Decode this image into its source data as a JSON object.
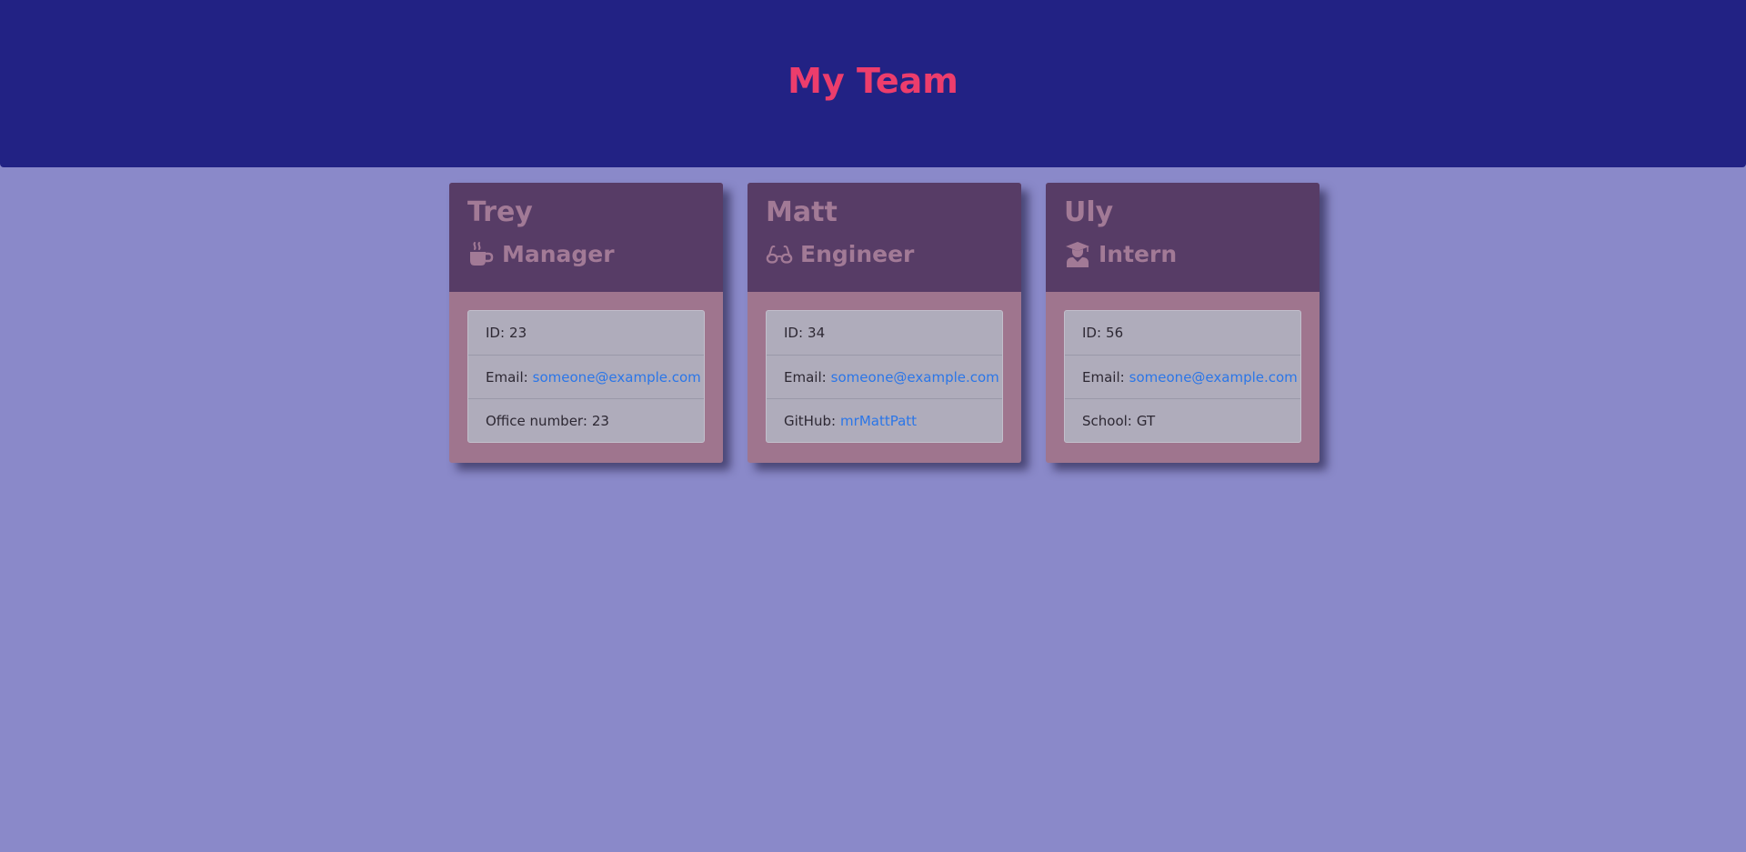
{
  "header": {
    "title": "My Team"
  },
  "colors": {
    "background": "#8a89c9",
    "header_background": "#222284",
    "title": "#ec3d6c",
    "card_header": "#573c66",
    "card_body": "#9f758e",
    "card_header_text": "#a27a96",
    "list_background": "#afacbb",
    "link": "#2b76e8"
  },
  "team": [
    {
      "name": "Trey",
      "role": "Manager",
      "icon": "mug-icon",
      "id_label": "ID:",
      "id": "23",
      "email_label": "Email:",
      "email": "someone@example.com",
      "extra_label": "Office number:",
      "extra_value": "23"
    },
    {
      "name": "Matt",
      "role": "Engineer",
      "icon": "glasses-icon",
      "id_label": "ID:",
      "id": "34",
      "email_label": "Email:",
      "email": "someone@example.com",
      "extra_label": "GitHub:",
      "extra_value": "mrMattPatt"
    },
    {
      "name": "Uly",
      "role": "Intern",
      "icon": "graduate-icon",
      "id_label": "ID:",
      "id": "56",
      "email_label": "Email:",
      "email": "someone@example.com",
      "extra_label": "School:",
      "extra_value": "GT"
    }
  ]
}
